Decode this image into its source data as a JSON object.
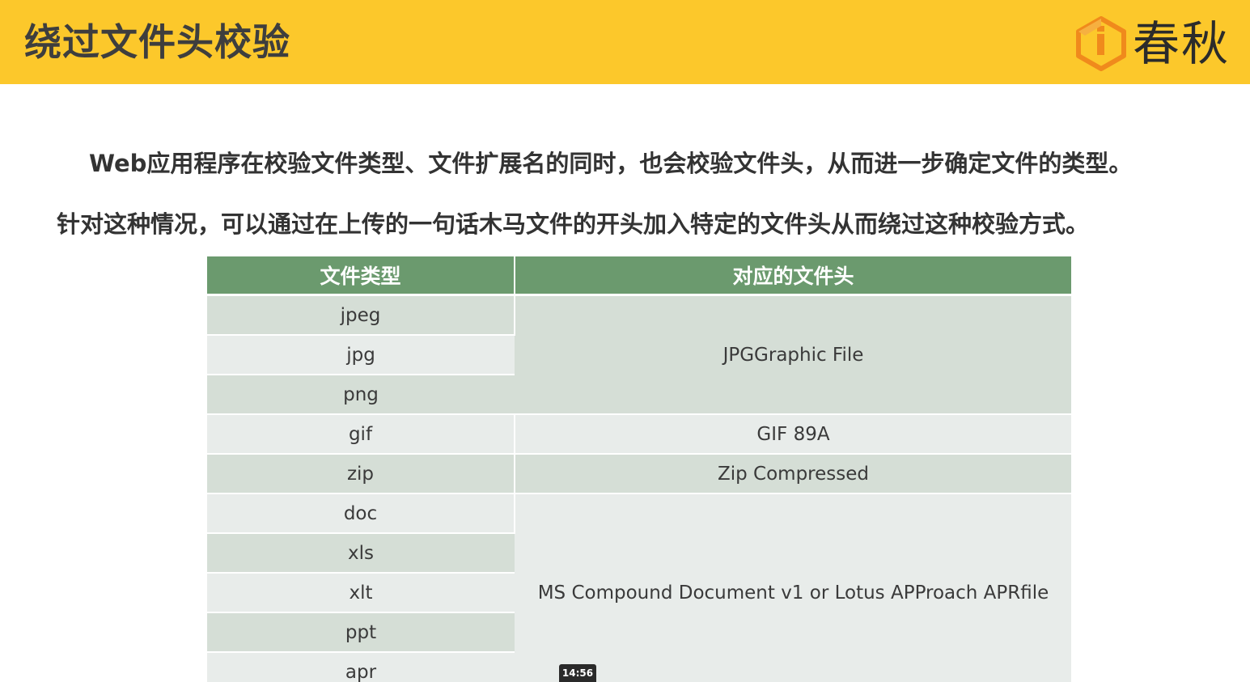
{
  "header": {
    "title": "绕过文件头校验",
    "logo_text": "春秋"
  },
  "body": {
    "paragraph1": "Web应用程序在校验文件类型、文件扩展名的同时，也会校验文件头，从而进一步确定文件的类型。",
    "paragraph2": "针对这种情况，可以通过在上传的一句话木马文件的开头加入特定的文件头从而绕过这种校验方式。"
  },
  "table": {
    "headers": [
      "文件类型",
      "对应的文件头"
    ],
    "rows": [
      {
        "type": "jpeg"
      },
      {
        "type": "jpg"
      },
      {
        "type": "png"
      },
      {
        "type": "gif"
      },
      {
        "type": "zip"
      },
      {
        "type": "doc"
      },
      {
        "type": "xls"
      },
      {
        "type": "xlt"
      },
      {
        "type": "ppt"
      },
      {
        "type": "apr"
      }
    ],
    "headers_values": {
      "jpg_group": "JPGGraphic File",
      "gif": "GIF 89A",
      "zip": "Zip Compressed",
      "ms_group": "MS Compound Document v1 or Lotus APProach APRfile"
    }
  },
  "video": {
    "timestamp": "14:56"
  },
  "colors": {
    "header_bg": "#fcc82b",
    "table_header_bg": "#6b9a6e",
    "row_dark": "#d5ded6",
    "row_light": "#e8ecea",
    "logo_orange": "#f08a1c"
  }
}
